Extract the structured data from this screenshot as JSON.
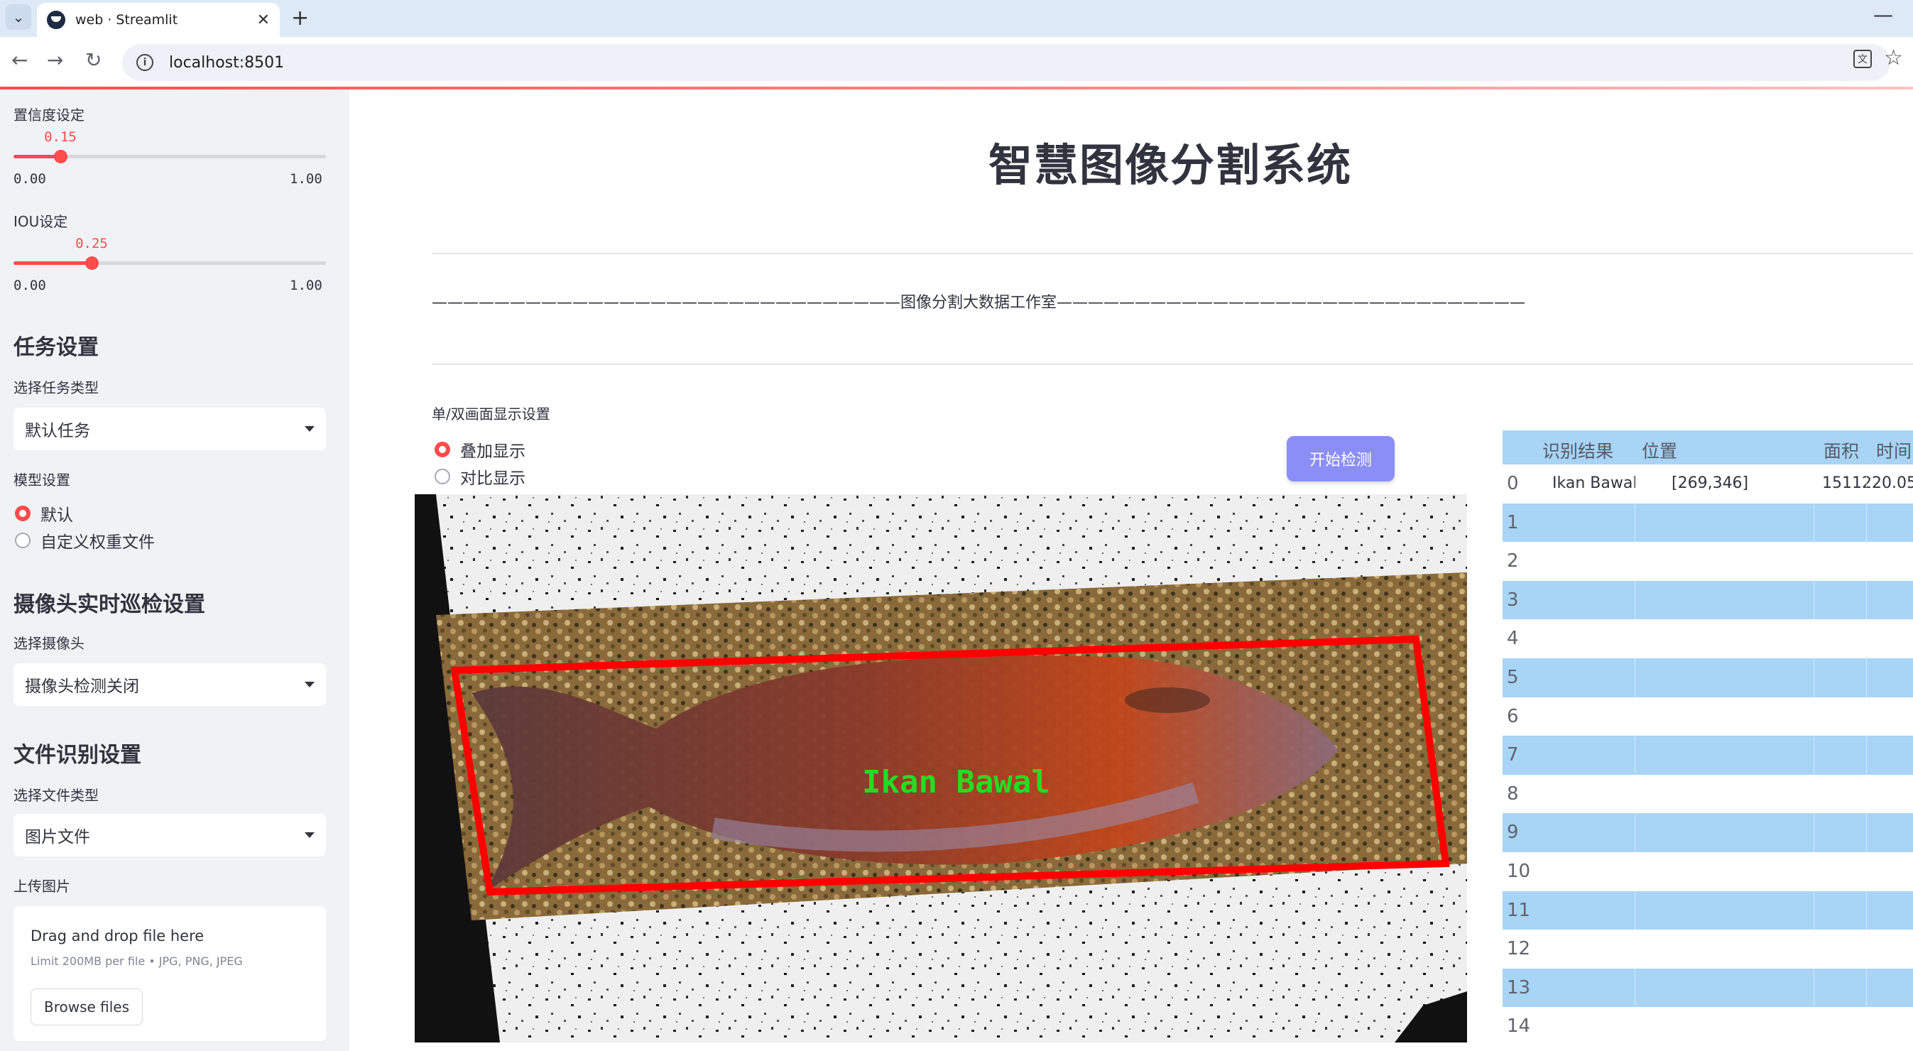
{
  "browser": {
    "tab_title": "web · Streamlit",
    "url": "localhost:8501"
  },
  "sidebar": {
    "confidence": {
      "label": "置信度设定",
      "value": "0.15",
      "min": "0.00",
      "max": "1.00",
      "fraction": 0.15
    },
    "iou": {
      "label": "IOU设定",
      "value": "0.25",
      "min": "0.00",
      "max": "1.00",
      "fraction": 0.25
    },
    "task_heading": "任务设置",
    "task_type_label": "选择任务类型",
    "task_type_value": "默认任务",
    "model_label": "模型设置",
    "model_options": [
      "默认",
      "自定义权重文件"
    ],
    "model_selected": 0,
    "camera_heading": "摄像头实时巡检设置",
    "camera_label": "选择摄像头",
    "camera_value": "摄像头检测关闭",
    "file_heading": "文件识别设置",
    "file_type_label": "选择文件类型",
    "file_type_value": "图片文件",
    "upload_label": "上传图片",
    "upload_title": "Drag and drop file here",
    "upload_sub": "Limit 200MB per file • JPG, PNG, JPEG",
    "upload_button": "Browse files"
  },
  "main": {
    "title": "智慧图像分割系统",
    "studio_line": "——————————————————————————————图像分割大数据工作室——————————————————————————————",
    "display_label": "单/双画面显示设置",
    "display_options": [
      "叠加显示",
      "对比显示"
    ],
    "display_selected": 0,
    "detect_button": "开始检测",
    "detection_label": "Ikan  Bawal"
  },
  "table": {
    "headers": [
      "识别结果",
      "位置",
      "面积",
      "时间"
    ],
    "rows": [
      {
        "index": "0",
        "result": "Ikan Bawal",
        "position": "[269,346]",
        "area": "151122",
        "time": "0.05"
      },
      {
        "index": "1"
      },
      {
        "index": "2"
      },
      {
        "index": "3"
      },
      {
        "index": "4"
      },
      {
        "index": "5"
      },
      {
        "index": "6"
      },
      {
        "index": "7"
      },
      {
        "index": "8"
      },
      {
        "index": "9"
      },
      {
        "index": "10"
      },
      {
        "index": "11"
      },
      {
        "index": "12"
      },
      {
        "index": "13"
      },
      {
        "index": "14"
      }
    ]
  },
  "colors": {
    "accent": "#ff4b4b",
    "button": "#8b8ef6",
    "table_stripe": "#a8d4f6",
    "detection_box": "#ff0000",
    "detection_text": "#22dd22"
  }
}
